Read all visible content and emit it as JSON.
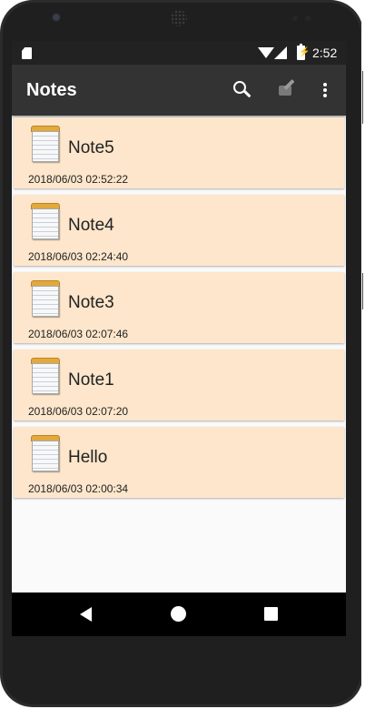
{
  "status_bar": {
    "time": "2:52",
    "icons": [
      "sd-card-icon",
      "wifi-icon",
      "signal-icon",
      "battery-charging-icon"
    ]
  },
  "app_bar": {
    "title": "Notes",
    "actions": [
      "search-icon",
      "edit-note-icon",
      "overflow-menu-icon"
    ]
  },
  "notes": [
    {
      "title": "Note5",
      "date": "2018/06/03 02:52:22"
    },
    {
      "title": "Note4",
      "date": "2018/06/03 02:24:40"
    },
    {
      "title": "Note3",
      "date": "2018/06/03 02:07:46"
    },
    {
      "title": "Note1",
      "date": "2018/06/03 02:07:20"
    },
    {
      "title": "Hello",
      "date": "2018/06/03 02:00:34"
    }
  ],
  "nav_bar": {
    "buttons": [
      "back-icon",
      "home-icon",
      "recent-apps-icon"
    ]
  },
  "colors": {
    "app_bar": "#333333",
    "status_bar": "#222222",
    "note_card": "#fde6cb",
    "list_bg": "#fafafa",
    "nav_bar": "#000000"
  }
}
